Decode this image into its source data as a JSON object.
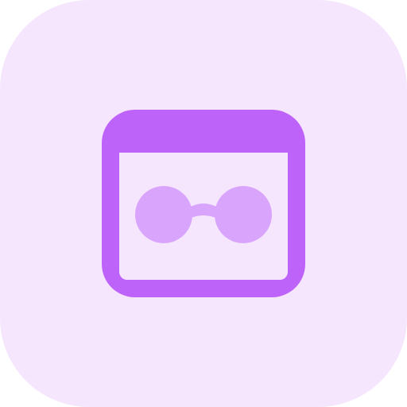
{
  "icon": {
    "name": "incognito-browser-icon",
    "background_color": "#f5e6fe",
    "frame_color": "#be63f9",
    "glasses_color": "#d9a4fc"
  }
}
